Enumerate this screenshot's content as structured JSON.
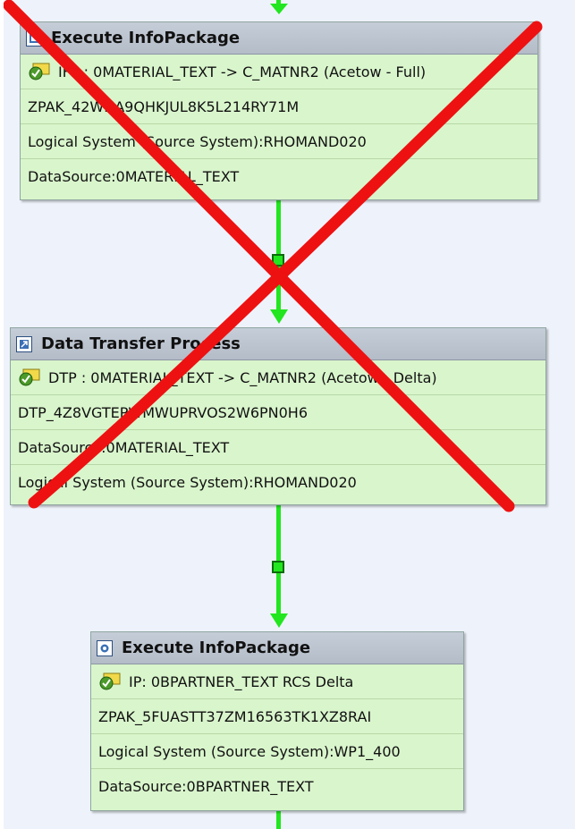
{
  "chain": {
    "steps": [
      {
        "title": "Execute InfoPackage",
        "rows": [
          "IFP : 0MATERIAL_TEXT -> C_MATNR2 (Acetow - Full)",
          "ZPAK_42WHA9QHKJUL8K5L214RY71M",
          "Logical System (Source System):RHOMAND020",
          "DataSource:0MATERIAL_TEXT"
        ]
      },
      {
        "title": "Data Transfer Process",
        "rows": [
          "DTP : 0MATERIAL_TEXT -> C_MATNR2 (Acetow - Delta)",
          "DTP_4Z8VGTEPWMWUPRVOS2W6PN0H6",
          "DataSource:0MATERIAL_TEXT",
          "Logical System (Source System):RHOMAND020"
        ]
      },
      {
        "title": "Execute InfoPackage",
        "rows": [
          "IP: 0BPARTNER_TEXT RCS Delta",
          "ZPAK_5FUASTT37ZM16563TK1XZ8RAI",
          "Logical System (Source System):WP1_400",
          "DataSource:0BPARTNER_TEXT"
        ]
      }
    ]
  },
  "colors": {
    "connector": "#22e61f",
    "box_body": "#d9f5cc",
    "header": "#bcc4cf",
    "cross_out": "#ee1111"
  },
  "icons": {
    "header": "process-type-icon",
    "row": "checked-variant-icon"
  }
}
